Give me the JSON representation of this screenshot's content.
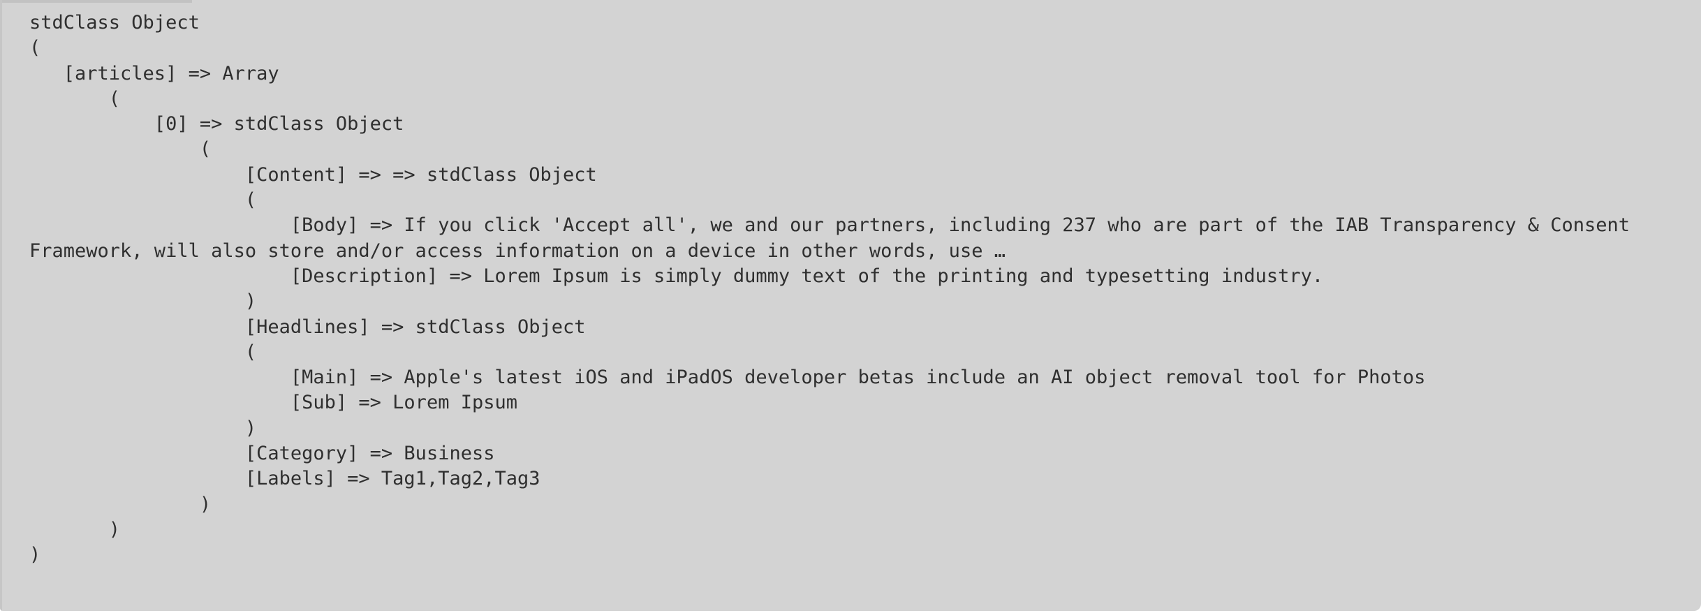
{
  "code_output": {
    "lines": [
      "stdClass Object",
      "(",
      "   [articles] => Array",
      "       (",
      "           [0] => stdClass Object",
      "               (",
      "                   [Content] => => stdClass Object",
      "                   (",
      "                       [Body] => If you click 'Accept all', we and our partners, including 237 who are part of the IAB Transparency & Consent",
      "Framework, will also store and/or access information on a device in other words, use …",
      "                       [Description] => Lorem Ipsum is simply dummy text of the printing and typesetting industry.",
      "                   )",
      "                   [Headlines] => stdClass Object",
      "                   (",
      "                       [Main] => Apple's latest iOS and iPadOS developer betas include an AI object removal tool for Photos",
      "                       [Sub] => Lorem Ipsum",
      "                   )",
      "                   [Category] => Business",
      "                   [Labels] => Tag1,Tag2,Tag3",
      "               )",
      "       )",
      ")"
    ]
  }
}
